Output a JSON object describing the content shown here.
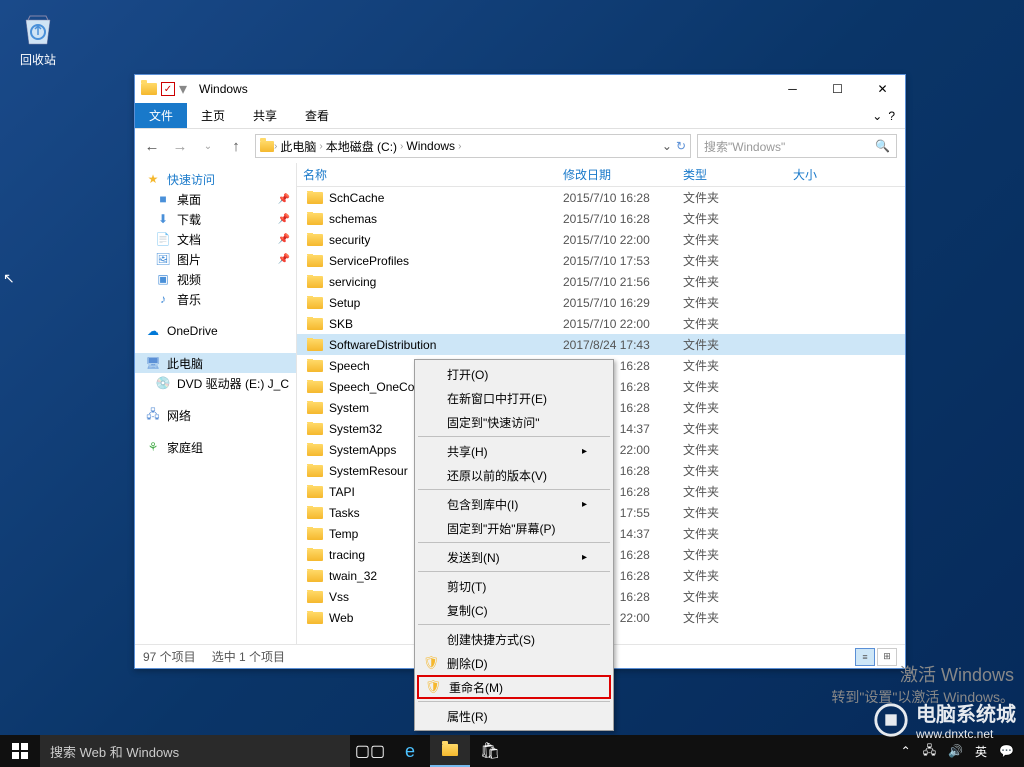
{
  "desktop": {
    "recycle_bin": "回收站"
  },
  "window": {
    "title": "Windows",
    "tabs": {
      "file": "文件",
      "home": "主页",
      "share": "共享",
      "view": "查看"
    },
    "breadcrumb": {
      "pc": "此电脑",
      "drive": "本地磁盘 (C:)",
      "folder": "Windows"
    },
    "search_placeholder": "搜索\"Windows\"",
    "columns": {
      "name": "名称",
      "date": "修改日期",
      "type": "类型",
      "size": "大小"
    },
    "type_folder": "文件夹",
    "files": [
      {
        "name": "SchCache",
        "date": "2015/7/10 16:28"
      },
      {
        "name": "schemas",
        "date": "2015/7/10 16:28"
      },
      {
        "name": "security",
        "date": "2015/7/10 22:00"
      },
      {
        "name": "ServiceProfiles",
        "date": "2015/7/10 17:53"
      },
      {
        "name": "servicing",
        "date": "2015/7/10 21:56"
      },
      {
        "name": "Setup",
        "date": "2015/7/10 16:29"
      },
      {
        "name": "SKB",
        "date": "2015/7/10 22:00"
      },
      {
        "name": "SoftwareDistribution",
        "date": "2017/8/24 17:43",
        "selected": true
      },
      {
        "name": "Speech",
        "date": "16:28",
        "clip": true
      },
      {
        "name": "Speech_OneCo",
        "date": "16:28",
        "clip": true
      },
      {
        "name": "System",
        "date": "16:28",
        "clip": true
      },
      {
        "name": "System32",
        "date": "14:37",
        "clip": true
      },
      {
        "name": "SystemApps",
        "date": "22:00",
        "clip": true
      },
      {
        "name": "SystemResour",
        "date": "16:28",
        "clip": true
      },
      {
        "name": "TAPI",
        "date": "16:28",
        "clip": true
      },
      {
        "name": "Tasks",
        "date": "17:55",
        "clip": true
      },
      {
        "name": "Temp",
        "date": "14:37",
        "clip": true
      },
      {
        "name": "tracing",
        "date": "16:28",
        "clip": true
      },
      {
        "name": "twain_32",
        "date": "16:28",
        "clip": true
      },
      {
        "name": "Vss",
        "date": "16:28",
        "clip": true
      },
      {
        "name": "Web",
        "date": "22:00",
        "clip": true
      }
    ],
    "status": {
      "items": "97 个项目",
      "selected": "选中 1 个项目"
    }
  },
  "sidebar": {
    "quick": "快速访问",
    "desktop": "桌面",
    "downloads": "下载",
    "documents": "文档",
    "pictures": "图片",
    "videos": "视频",
    "music": "音乐",
    "onedrive": "OneDrive",
    "this_pc": "此电脑",
    "dvd": "DVD 驱动器 (E:) J_C",
    "network": "网络",
    "homegroup": "家庭组"
  },
  "context_menu": {
    "open": "打开(O)",
    "open_new": "在新窗口中打开(E)",
    "pin_quick": "固定到\"快速访问\"",
    "share": "共享(H)",
    "restore": "还原以前的版本(V)",
    "include_lib": "包含到库中(I)",
    "pin_start": "固定到\"开始\"屏幕(P)",
    "send_to": "发送到(N)",
    "cut": "剪切(T)",
    "copy": "复制(C)",
    "shortcut": "创建快捷方式(S)",
    "delete": "删除(D)",
    "rename": "重命名(M)",
    "properties": "属性(R)"
  },
  "watermark": {
    "line1": "激活 Windows",
    "line2": "转到\"设置\"以激活 Windows。"
  },
  "site_watermark": {
    "text": "电脑系统城",
    "url": "www.dnxtc.net"
  },
  "taskbar": {
    "search": "搜索 Web 和 Windows"
  }
}
